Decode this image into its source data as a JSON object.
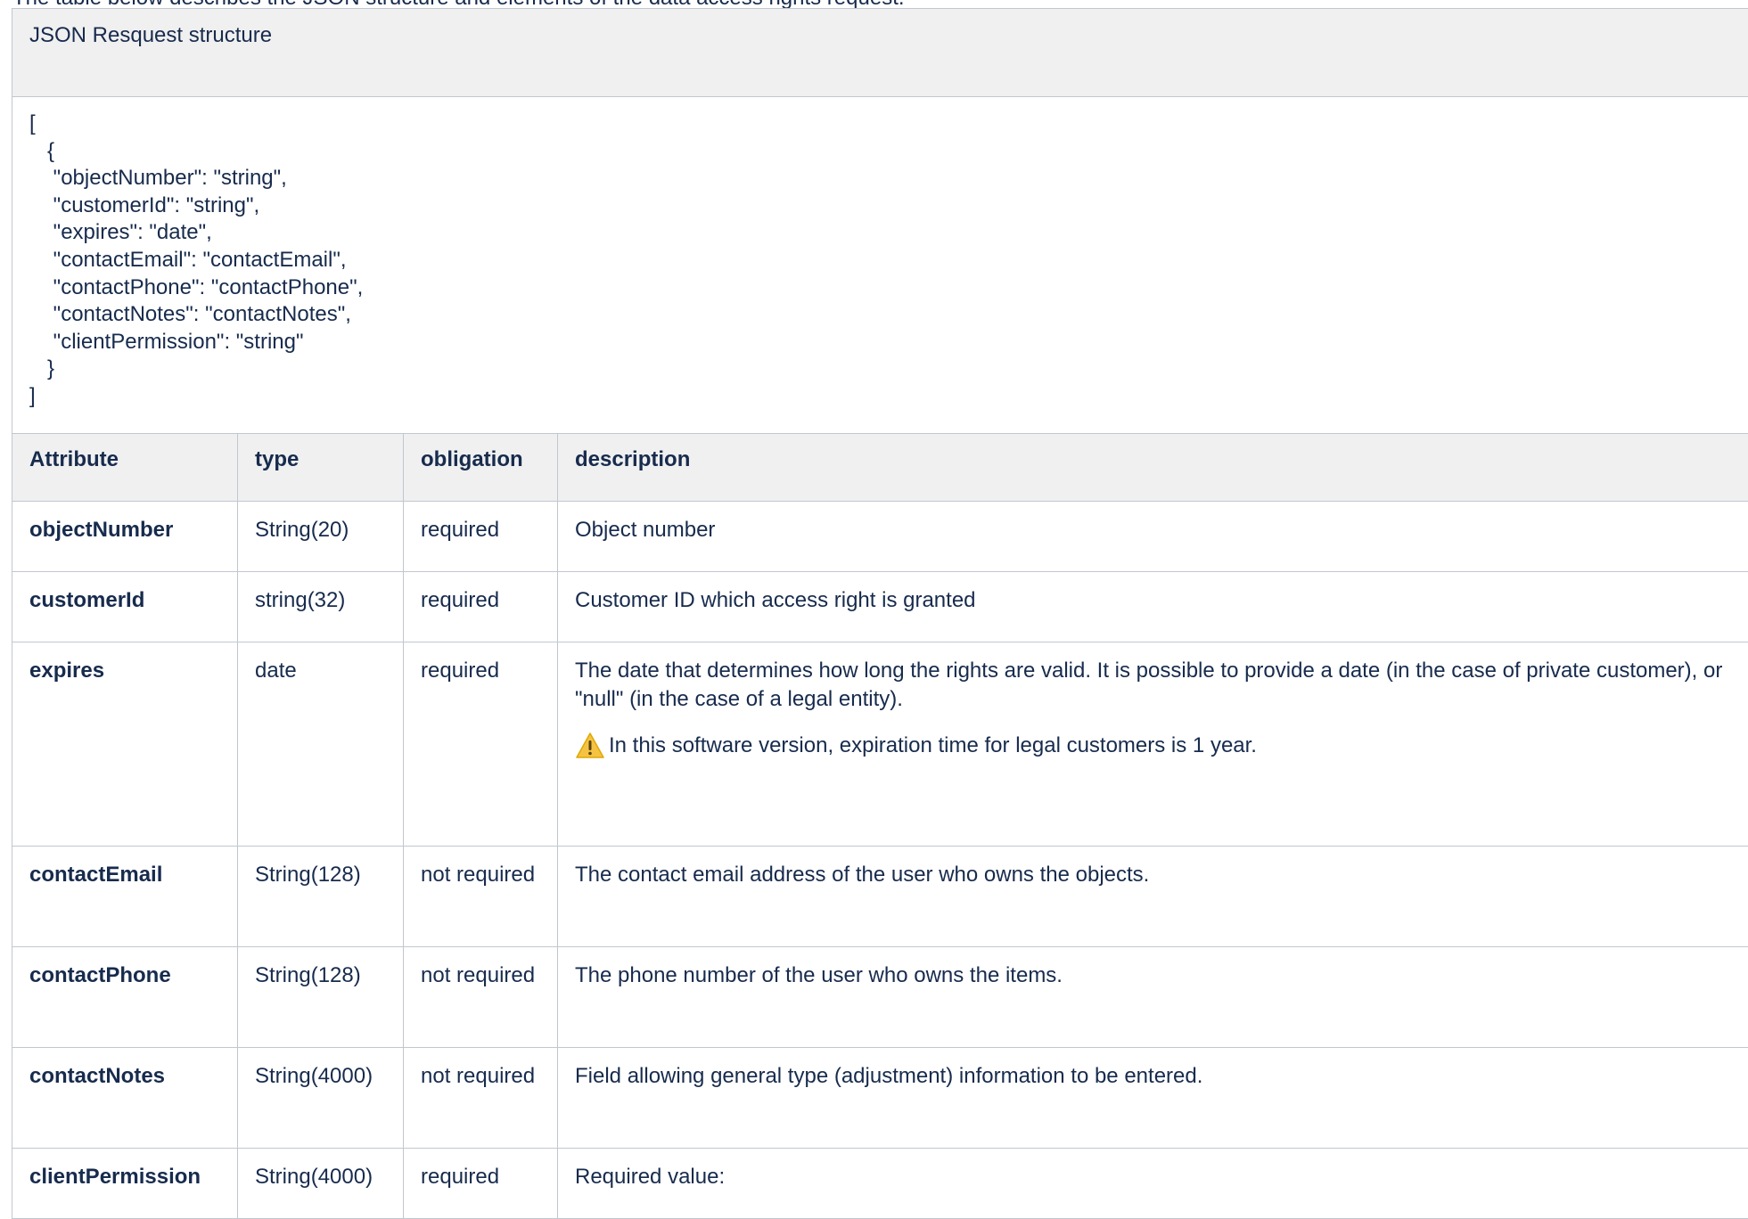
{
  "intro_text": "The table below describes the JSON structure and elements of the data access rights request.",
  "caption": "JSON Resquest structure",
  "code_lines": [
    "[",
    "   {",
    "    \"objectNumber\": \"string\",",
    "    \"customerId\": \"string\",",
    "    \"expires\": \"date\",",
    "    \"contactEmail\": \"contactEmail\",",
    "    \"contactPhone\": \"contactPhone\",",
    "    \"contactNotes\": \"contactNotes\",",
    "    \"clientPermission\": \"string\"",
    "   }",
    "]"
  ],
  "headers": {
    "attribute": "Attribute",
    "type": "type",
    "obligation": "obligation",
    "description": "description"
  },
  "rows": [
    {
      "attribute": "objectNumber",
      "type": "String(20)",
      "obligation": "required",
      "description": "Object number"
    },
    {
      "attribute": "customerId",
      "type": "string(32)",
      "obligation": "required",
      "description": "Customer ID which access right is granted"
    },
    {
      "attribute": "expires",
      "type": "date",
      "obligation": "required",
      "description": "The date that determines how long the rights are valid. It is possible to provide a date (in the case of private customer), or \"null\" (in the case of a legal entity).",
      "note": "In this software version, expiration time for legal customers is 1 year.",
      "note_icon": "warning-icon"
    },
    {
      "attribute": "contactEmail",
      "type": "String(128)",
      "obligation": "not required",
      "description": "The contact email address of the user who owns the objects."
    },
    {
      "attribute": "contactPhone",
      "type": "String(128)",
      "obligation": "not required",
      "description": "The phone number of the user who owns the items."
    },
    {
      "attribute": "contactNotes",
      "type": "String(4000)",
      "obligation": "not required",
      "description": "Field allowing general type (adjustment) information to be entered."
    },
    {
      "attribute": "clientPermission",
      "type": "String(4000)",
      "obligation": "required",
      "description": "Required value:"
    }
  ],
  "colors": {
    "header_bg": "#f0f0f0",
    "border": "#c1c7d0",
    "text": "#172b4d",
    "warning": "#f5c344"
  }
}
